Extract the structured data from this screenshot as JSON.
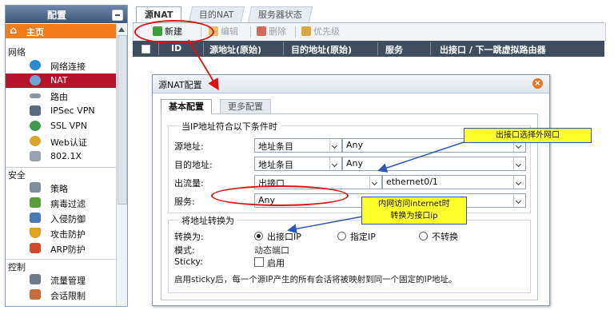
{
  "sidebar": {
    "header": "配置",
    "home": "主页",
    "sections": [
      {
        "title": "网络",
        "items": [
          "网络连接",
          "NAT",
          "路由",
          "IPSec VPN",
          "SSL VPN",
          "Web认证",
          "802.1X"
        ]
      },
      {
        "title": "安全",
        "items": [
          "策略",
          "病毒过滤",
          "入侵防御",
          "攻击防护",
          "ARP防护"
        ]
      },
      {
        "title": "控制",
        "items": [
          "流量管理",
          "会话限制"
        ]
      }
    ],
    "active_item": "NAT"
  },
  "tabs": [
    "源NAT",
    "目的NAT",
    "服务器状态"
  ],
  "toolbar": {
    "new": "新建",
    "edit": "编辑",
    "delete": "删除",
    "priority": "优先级"
  },
  "table_header": [
    "ID",
    "源地址(原始)",
    "目的地址(原始)",
    "服务",
    "出接口 / 下一跳虚拟路由器"
  ],
  "dialog": {
    "title": "源NAT配置",
    "tabs": [
      "基本配置",
      "更多配置"
    ],
    "condition_legend": "当IP地址符合以下条件时",
    "src_label": "源地址:",
    "src_type": "地址条目",
    "src_value": "Any",
    "dst_label": "目的地址:",
    "dst_type": "地址条目",
    "dst_value": "Any",
    "egress_label": "出流量:",
    "egress_type": "出接口",
    "egress_value": "ethernet0/1",
    "service_label": "服务:",
    "service_value": "Any",
    "translate_legend": "将地址转换为",
    "translate_label": "转换为:",
    "translate_options": [
      "出接口IP",
      "指定IP",
      "不转换"
    ],
    "translate_selected": "出接口IP",
    "mode_label": "模式:",
    "mode_value": "动态端口",
    "sticky_label": "Sticky:",
    "sticky_option": "启用",
    "sticky_note": "启用sticky后，每一个源IP产生的所有会话将被映射到同一个固定的IP地址。"
  },
  "annotations": {
    "callout1": "出接口选择外网口",
    "callout2_line1": "内网访问internet时",
    "callout2_line2": "转换为接口ip"
  },
  "colors": {
    "home": "#f07c1a",
    "active": "#b5142a",
    "header": "#3f4d5f",
    "callout": "#ffff2a",
    "highlight": "#dd1111"
  }
}
